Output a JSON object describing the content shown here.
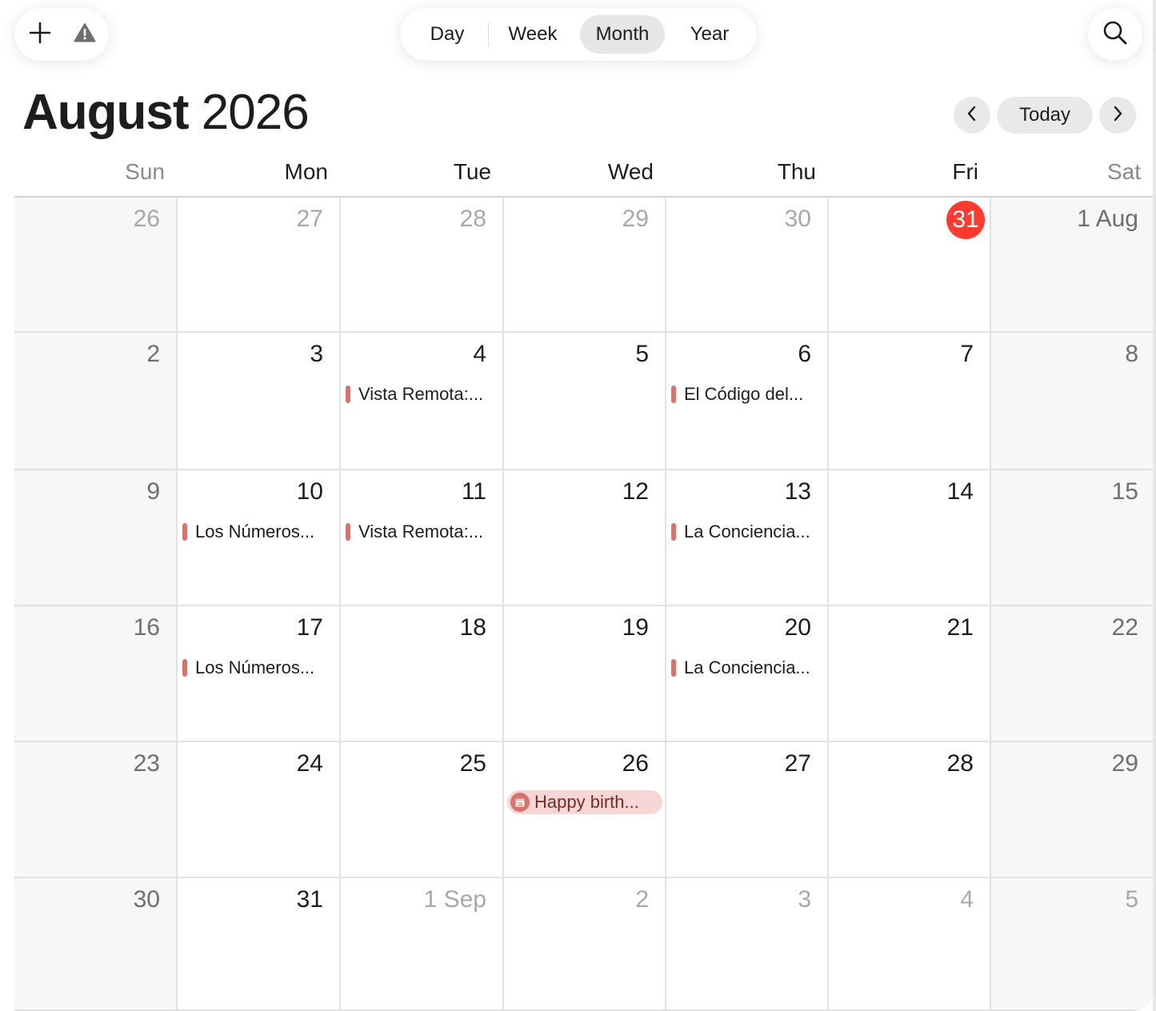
{
  "toolbar": {
    "add_icon": "plus-icon",
    "warning_icon": "warning-triangle-icon",
    "search_icon": "magnifier-icon",
    "views": [
      {
        "label": "Day",
        "active": false
      },
      {
        "label": "Week",
        "active": false
      },
      {
        "label": "Month",
        "active": true
      },
      {
        "label": "Year",
        "active": false
      }
    ]
  },
  "header": {
    "month": "August",
    "year": "2026",
    "today_label": "Today",
    "prev_icon": "chevron-left-icon",
    "next_icon": "chevron-right-icon"
  },
  "weekdays": [
    "Sun",
    "Mon",
    "Tue",
    "Wed",
    "Thu",
    "Fri",
    "Sat"
  ],
  "weeks": [
    {
      "days": [
        {
          "label": "26",
          "in_month": false
        },
        {
          "label": "27",
          "in_month": false
        },
        {
          "label": "28",
          "in_month": false
        },
        {
          "label": "29",
          "in_month": false
        },
        {
          "label": "30",
          "in_month": false
        },
        {
          "label": "31",
          "in_month": false,
          "today": true
        },
        {
          "label": "1 Aug",
          "in_month": true
        }
      ]
    },
    {
      "days": [
        {
          "label": "2",
          "in_month": true
        },
        {
          "label": "3",
          "in_month": true
        },
        {
          "label": "4",
          "in_month": true,
          "events": [
            {
              "title": "Vista Remota:..."
            }
          ]
        },
        {
          "label": "5",
          "in_month": true
        },
        {
          "label": "6",
          "in_month": true,
          "events": [
            {
              "title": "El Código del..."
            }
          ]
        },
        {
          "label": "7",
          "in_month": true
        },
        {
          "label": "8",
          "in_month": true
        }
      ]
    },
    {
      "days": [
        {
          "label": "9",
          "in_month": true
        },
        {
          "label": "10",
          "in_month": true,
          "events": [
            {
              "title": "Los Números..."
            }
          ]
        },
        {
          "label": "11",
          "in_month": true,
          "events": [
            {
              "title": "Vista Remota:..."
            }
          ]
        },
        {
          "label": "12",
          "in_month": true
        },
        {
          "label": "13",
          "in_month": true,
          "events": [
            {
              "title": "La Conciencia..."
            }
          ]
        },
        {
          "label": "14",
          "in_month": true
        },
        {
          "label": "15",
          "in_month": true
        }
      ]
    },
    {
      "days": [
        {
          "label": "16",
          "in_month": true
        },
        {
          "label": "17",
          "in_month": true,
          "events": [
            {
              "title": "Los Números..."
            }
          ]
        },
        {
          "label": "18",
          "in_month": true
        },
        {
          "label": "19",
          "in_month": true
        },
        {
          "label": "20",
          "in_month": true,
          "events": [
            {
              "title": "La Conciencia..."
            }
          ]
        },
        {
          "label": "21",
          "in_month": true
        },
        {
          "label": "22",
          "in_month": true
        }
      ]
    },
    {
      "days": [
        {
          "label": "23",
          "in_month": true
        },
        {
          "label": "24",
          "in_month": true
        },
        {
          "label": "25",
          "in_month": true
        },
        {
          "label": "26",
          "in_month": true,
          "events": [
            {
              "title": "Happy birth...",
              "all_day": true,
              "icon": "birthday-calendar-icon"
            }
          ]
        },
        {
          "label": "27",
          "in_month": true
        },
        {
          "label": "28",
          "in_month": true
        },
        {
          "label": "29",
          "in_month": true
        }
      ]
    },
    {
      "days": [
        {
          "label": "30",
          "in_month": true
        },
        {
          "label": "31",
          "in_month": true
        },
        {
          "label": "1 Sep",
          "in_month": false
        },
        {
          "label": "2",
          "in_month": false
        },
        {
          "label": "3",
          "in_month": false
        },
        {
          "label": "4",
          "in_month": false
        },
        {
          "label": "5",
          "in_month": false
        }
      ]
    }
  ],
  "colors": {
    "today_badge": "#ff3b30",
    "event_bar": "#d9726a",
    "allday_bg": "#f7d6d6",
    "weekend_bg": "#f7f7f7"
  }
}
